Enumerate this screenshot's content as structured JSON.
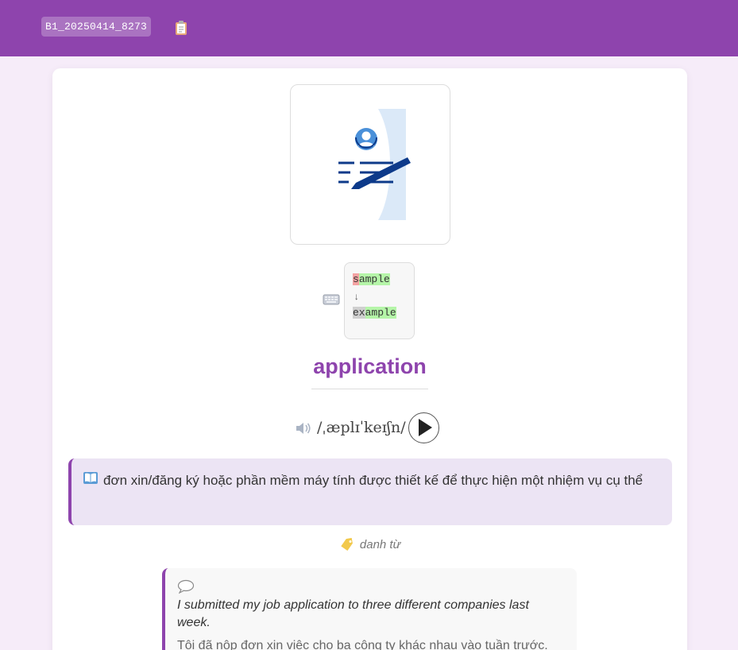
{
  "header": {
    "deck_id": "B1_20250414_8273",
    "clipboard_icon": "clipboard-icon",
    "accent_color": "#8e44ad"
  },
  "card": {
    "image_icon": "job-application-document-icon",
    "spelling_diff": {
      "icon": "keyboard-icon",
      "from_word": [
        "s",
        "ample"
      ],
      "arrow": "↓",
      "to_word": [
        "ex",
        "ample"
      ]
    },
    "word": "application",
    "pronunciation": {
      "icon": "speaker-icon",
      "ipa": "/ˌæplɪˈkeɪʃn/",
      "play_icon": "play-icon"
    },
    "definition": {
      "icon": "book-icon",
      "text": "đơn xin/đăng ký hoặc phần mềm máy tính được thiết kế để thực hiện một nhiệm vụ cụ thể"
    },
    "part_of_speech": {
      "icon": "tag-icon",
      "text": "danh từ"
    },
    "example": {
      "icon": "speech-bubble-icon",
      "english": "I submitted my job application to three different companies last week.",
      "vietnamese": "Tôi đã nộp đơn xin việc cho ba công ty khác nhau vào tuần trước."
    }
  }
}
